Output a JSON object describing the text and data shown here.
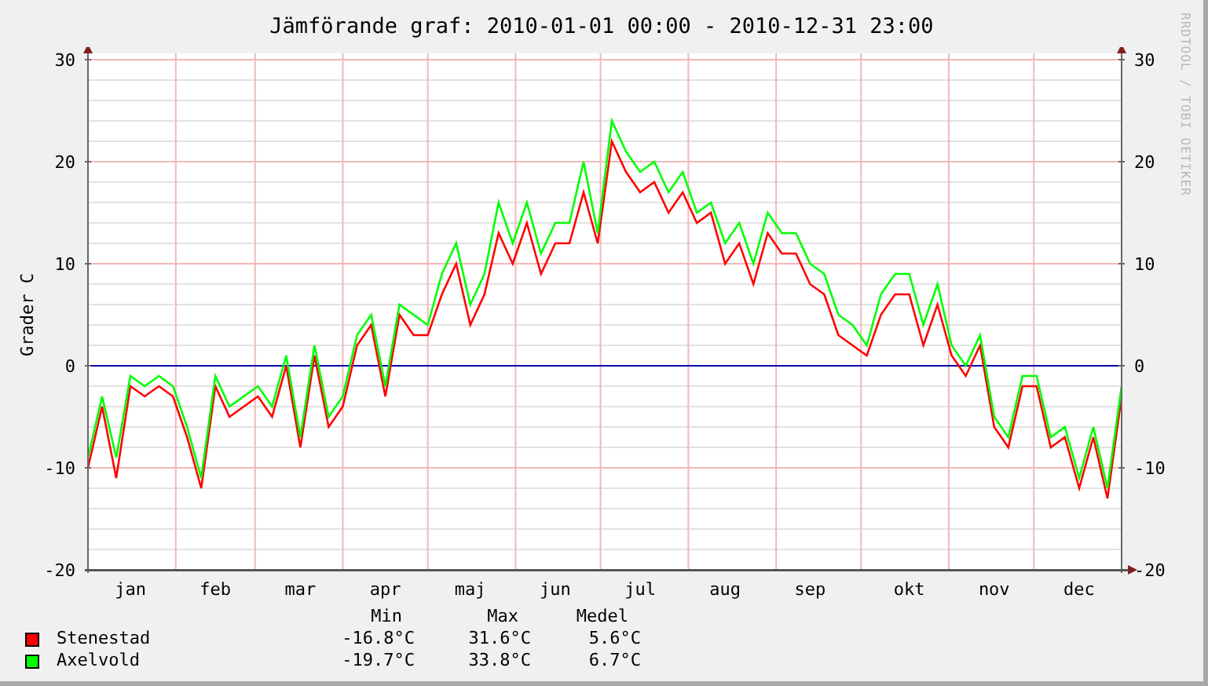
{
  "title": "Jämförande graf: 2010-01-01 00:00 - 2010-12-31 23:00",
  "credit": "RRDTOOL / TOBI OETIKER",
  "chart_data": {
    "type": "line",
    "ylabel": "Grader C",
    "ylim": [
      -20,
      30
    ],
    "y2lim": [
      -20,
      30
    ],
    "grid": true,
    "ref_lines": [
      {
        "axis": "y",
        "value": 0,
        "color": "#0000b0"
      }
    ],
    "yticks": [
      -20,
      -10,
      0,
      10,
      20,
      30
    ],
    "y2ticks": [
      -20,
      -10,
      0,
      10,
      20,
      30
    ],
    "categories": [
      null,
      null,
      null,
      "jan",
      null,
      null,
      null,
      null,
      null,
      "feb",
      null,
      null,
      null,
      null,
      null,
      "mar",
      null,
      null,
      null,
      null,
      null,
      "apr",
      null,
      null,
      null,
      null,
      null,
      "maj",
      null,
      null,
      null,
      null,
      null,
      "jun",
      null,
      null,
      null,
      null,
      null,
      "jul",
      null,
      null,
      null,
      null,
      null,
      "aug",
      null,
      null,
      null,
      null,
      null,
      "sep",
      null,
      null,
      null,
      null,
      null,
      null,
      "okt",
      null,
      null,
      null,
      null,
      null,
      "nov",
      null,
      null,
      null,
      null,
      null,
      "dec",
      null,
      null,
      null
    ],
    "series": [
      {
        "name": "Stenestad",
        "color": "#ff0000",
        "values": [
          -10,
          -4,
          -11,
          -2,
          -3,
          -2,
          -3,
          -7,
          -12,
          -2,
          -5,
          -4,
          -3,
          -5,
          0,
          -8,
          1,
          -6,
          -4,
          2,
          4,
          -3,
          5,
          3,
          3,
          7,
          10,
          4,
          7,
          13,
          10,
          14,
          9,
          12,
          12,
          17,
          12,
          22,
          19,
          17,
          18,
          15,
          17,
          14,
          15,
          10,
          12,
          8,
          13,
          11,
          11,
          8,
          7,
          3,
          2,
          1,
          5,
          7,
          7,
          2,
          6,
          1,
          -1,
          2,
          -6,
          -8,
          -2,
          -2,
          -8,
          -7,
          -12,
          -7,
          -13,
          -3
        ]
      },
      {
        "name": "Axelvold",
        "color": "#00ff00",
        "values": [
          -9,
          -3,
          -9,
          -1,
          -2,
          -1,
          -2,
          -6,
          -11,
          -1,
          -4,
          -3,
          -2,
          -4,
          1,
          -7,
          2,
          -5,
          -3,
          3,
          5,
          -2,
          6,
          5,
          4,
          9,
          12,
          6,
          9,
          16,
          12,
          16,
          11,
          14,
          14,
          20,
          13,
          24,
          21,
          19,
          20,
          17,
          19,
          15,
          16,
          12,
          14,
          10,
          15,
          13,
          13,
          10,
          9,
          5,
          4,
          2,
          7,
          9,
          9,
          4,
          8,
          2,
          0,
          3,
          -5,
          -7,
          -1,
          -1,
          -7,
          -6,
          -11,
          -6,
          -12,
          -2
        ]
      }
    ]
  },
  "legend": {
    "columns": [
      "Min",
      "Max",
      "Medel"
    ],
    "rows": [
      {
        "min": "-16.8°C",
        "max": "31.6°C",
        "mean": "5.6°C"
      },
      {
        "min": "-19.7°C",
        "max": "33.8°C",
        "mean": "6.7°C"
      }
    ]
  }
}
